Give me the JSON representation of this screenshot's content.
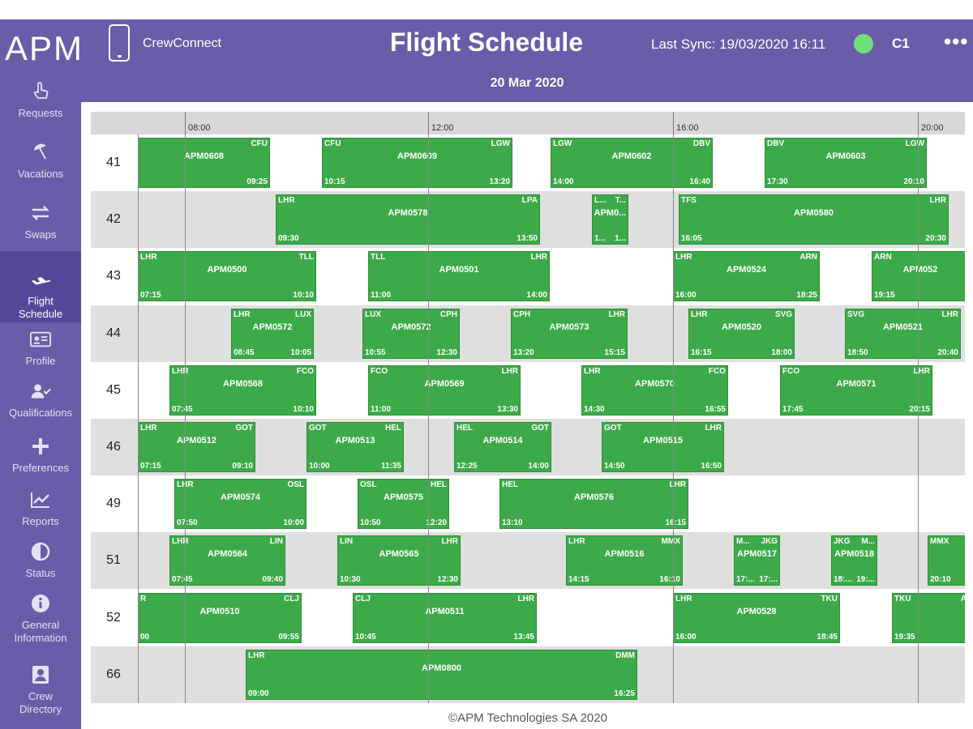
{
  "header": {
    "logo": "APM",
    "app_name": "CrewConnect",
    "title": "Flight Schedule",
    "last_sync": "Last Sync: 19/03/2020 16:11",
    "sync_status_color": "#6ee07a",
    "crew_code": "C1",
    "more_icon": "more-horizontal-icon",
    "date": "20 Mar 2020"
  },
  "sidebar": {
    "items": [
      {
        "label": "Requests",
        "icon": "hand-pointer-icon",
        "active": false
      },
      {
        "label": "Vacations",
        "icon": "beach-umbrella-icon",
        "active": false
      },
      {
        "label": "Swaps",
        "icon": "swap-arrows-icon",
        "active": false
      },
      {
        "label": "Flight\nSchedule",
        "icon": "airplane-icon",
        "active": true
      },
      {
        "label": "Profile",
        "icon": "id-card-icon",
        "active": false
      },
      {
        "label": "Qualifications",
        "icon": "user-check-icon",
        "active": false
      },
      {
        "label": "Preferences",
        "icon": "plus-icon",
        "active": false
      },
      {
        "label": "Reports",
        "icon": "chart-line-icon",
        "active": false
      },
      {
        "label": "Status",
        "icon": "half-circle-icon",
        "active": false
      },
      {
        "label": "General\nInformation",
        "icon": "info-icon",
        "active": false
      },
      {
        "label": "Crew\nDirectory",
        "icon": "contact-card-icon",
        "active": false
      }
    ]
  },
  "timeline": {
    "ticks": [
      "08:00",
      "12:00",
      "16:00",
      "20:00"
    ]
  },
  "rows": [
    {
      "id": "41",
      "flights": [
        {
          "from": "",
          "to": "CFU",
          "code": "APM0608",
          "dep": "",
          "arr": "09:25"
        },
        {
          "from": "CFU",
          "to": "LGW",
          "code": "APM0609",
          "dep": "10:15",
          "arr": "13:20"
        },
        {
          "from": "LGW",
          "to": "DBV",
          "code": "APM0602",
          "dep": "14:00",
          "arr": "16:40"
        },
        {
          "from": "DBV",
          "to": "LGW",
          "code": "APM0603",
          "dep": "17:30",
          "arr": "20:10"
        }
      ]
    },
    {
      "id": "42",
      "flights": [
        {
          "from": "LHR",
          "to": "LPA",
          "code": "APM0578",
          "dep": "09:30",
          "arr": "13:50"
        },
        {
          "from": "L...",
          "to": "T...",
          "code": "APM0...",
          "dep": "1...",
          "arr": "1..."
        },
        {
          "from": "TFS",
          "to": "LHR",
          "code": "APM0580",
          "dep": "16:05",
          "arr": "20:30"
        }
      ]
    },
    {
      "id": "43",
      "flights": [
        {
          "from": "LHR",
          "to": "TLL",
          "code": "APM0500",
          "dep": "07:15",
          "arr": "10:10"
        },
        {
          "from": "TLL",
          "to": "LHR",
          "code": "APM0501",
          "dep": "11:00",
          "arr": "14:00"
        },
        {
          "from": "LHR",
          "to": "ARN",
          "code": "APM0524",
          "dep": "16:00",
          "arr": "18:25"
        },
        {
          "from": "ARN",
          "to": "",
          "code": "APM052",
          "dep": "19:15",
          "arr": ""
        }
      ]
    },
    {
      "id": "44",
      "flights": [
        {
          "from": "LHR",
          "to": "LUX",
          "code": "APM0572",
          "dep": "08:45",
          "arr": "10:05"
        },
        {
          "from": "LUX",
          "to": "CPH",
          "code": "APM0572",
          "dep": "10:55",
          "arr": "12:30"
        },
        {
          "from": "CPH",
          "to": "LHR",
          "code": "APM0573",
          "dep": "13:20",
          "arr": "15:15"
        },
        {
          "from": "LHR",
          "to": "SVG",
          "code": "APM0520",
          "dep": "16:15",
          "arr": "18:00"
        },
        {
          "from": "SVG",
          "to": "LHR",
          "code": "APM0521",
          "dep": "18:50",
          "arr": "20:40"
        }
      ]
    },
    {
      "id": "45",
      "flights": [
        {
          "from": "LHR",
          "to": "FCO",
          "code": "APM0568",
          "dep": "07:45",
          "arr": "10:10"
        },
        {
          "from": "FCO",
          "to": "LHR",
          "code": "APM0569",
          "dep": "11:00",
          "arr": "13:30"
        },
        {
          "from": "LHR",
          "to": "FCO",
          "code": "APM0570",
          "dep": "14:30",
          "arr": "16:55"
        },
        {
          "from": "FCO",
          "to": "LHR",
          "code": "APM0571",
          "dep": "17:45",
          "arr": "20:15"
        }
      ]
    },
    {
      "id": "46",
      "flights": [
        {
          "from": "LHR",
          "to": "GOT",
          "code": "APM0512",
          "dep": "07:15",
          "arr": "09:10"
        },
        {
          "from": "GOT",
          "to": "HEL",
          "code": "APM0513",
          "dep": "10:00",
          "arr": "11:35"
        },
        {
          "from": "HEL",
          "to": "GOT",
          "code": "APM0514",
          "dep": "12:25",
          "arr": "14:00"
        },
        {
          "from": "GOT",
          "to": "LHR",
          "code": "APM0515",
          "dep": "14:50",
          "arr": "16:50"
        }
      ]
    },
    {
      "id": "49",
      "flights": [
        {
          "from": "LHR",
          "to": "OSL",
          "code": "APM0574",
          "dep": "07:50",
          "arr": "10:00"
        },
        {
          "from": "OSL",
          "to": "HEL",
          "code": "APM0575",
          "dep": "10:50",
          "arr": "12:20"
        },
        {
          "from": "HEL",
          "to": "LHR",
          "code": "APM0576",
          "dep": "13:10",
          "arr": "16:15"
        }
      ]
    },
    {
      "id": "51",
      "flights": [
        {
          "from": "LHR",
          "to": "LIN",
          "code": "APM0564",
          "dep": "07:45",
          "arr": "09:40"
        },
        {
          "from": "LIN",
          "to": "LHR",
          "code": "APM0565",
          "dep": "10:30",
          "arr": "12:30"
        },
        {
          "from": "LHR",
          "to": "MMX",
          "code": "APM0516",
          "dep": "14:15",
          "arr": "16:10"
        },
        {
          "from": "M...",
          "to": "JKG",
          "code": "APM0517",
          "dep": "17:...",
          "arr": "17:..."
        },
        {
          "from": "JKG",
          "to": "M...",
          "code": "APM0518",
          "dep": "18:...",
          "arr": "19:..."
        },
        {
          "from": "MMX",
          "to": "",
          "code": "",
          "dep": "20:10",
          "arr": ""
        }
      ]
    },
    {
      "id": "52",
      "flights": [
        {
          "from": "R",
          "to": "CLJ",
          "code": "APM0510",
          "dep": "00",
          "arr": "09:55"
        },
        {
          "from": "CLJ",
          "to": "LHR",
          "code": "APM0511",
          "dep": "10:45",
          "arr": "13:45"
        },
        {
          "from": "LHR",
          "to": "TKU",
          "code": "APM0528",
          "dep": "16:00",
          "arr": "18:45"
        },
        {
          "from": "TKU",
          "to": "A",
          "code": "",
          "dep": "19:35",
          "arr": ""
        }
      ]
    },
    {
      "id": "66",
      "flights": [
        {
          "from": "LHR",
          "to": "DMM",
          "code": "APM0800",
          "dep": "09:00",
          "arr": "16:25"
        }
      ]
    }
  ],
  "footer": "©APM Technologies SA 2020",
  "colors": {
    "brand": "#6a5ca8",
    "flight": "#3caa48"
  }
}
